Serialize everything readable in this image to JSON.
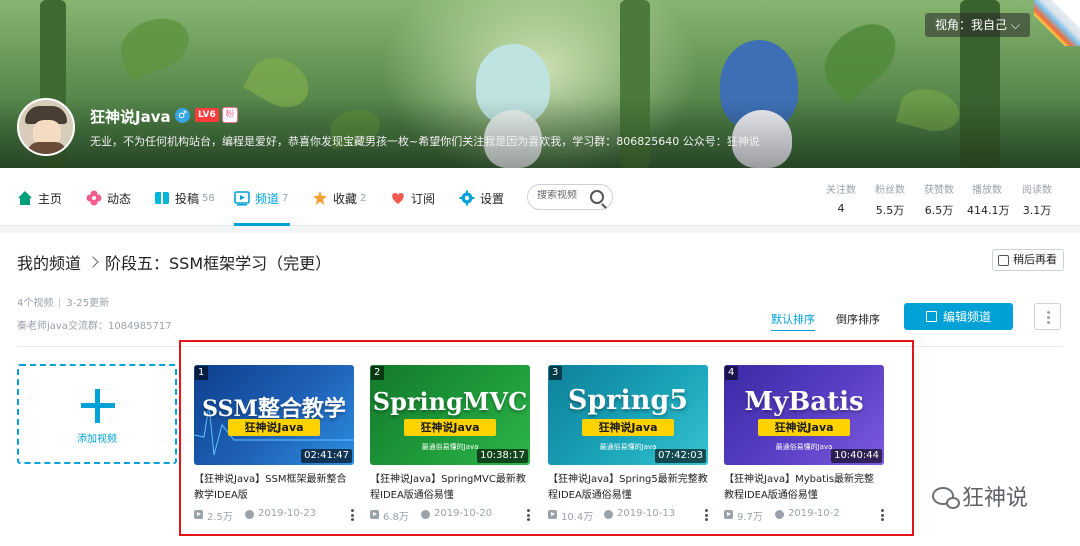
{
  "banner": {
    "view_as": "视角：我自己",
    "username": "狂神说Java",
    "level_badge": "LV6",
    "fan_badge": "粉",
    "sign": "无业，不为任何机构站台，编程是爱好，恭喜你发现宝藏男孩一枚~希望你们关注我是因为喜欢我，学习群：806825640 公众号：狂神说"
  },
  "nav": {
    "items": [
      {
        "label": "主页",
        "count": "",
        "icon": "home-icon",
        "color": "#00a07a"
      },
      {
        "label": "动态",
        "count": "",
        "icon": "flower-icon",
        "color": "#f25d8e"
      },
      {
        "label": "投稿",
        "count": "58",
        "icon": "upload-icon",
        "color": "#02b5da"
      },
      {
        "label": "频道",
        "count": "7",
        "icon": "channel-icon",
        "color": "#00a1d6"
      },
      {
        "label": "收藏",
        "count": "2",
        "icon": "star-icon",
        "color": "#f3a034"
      },
      {
        "label": "订阅",
        "count": "",
        "icon": "heart-icon",
        "color": "#f45a50"
      },
      {
        "label": "设置",
        "count": "",
        "icon": "gear-icon",
        "color": "#00a1d6"
      }
    ],
    "active": "频道",
    "search_placeholder": "搜索视频"
  },
  "stats": [
    {
      "label": "关注数",
      "value": "4"
    },
    {
      "label": "粉丝数",
      "value": "5.5万"
    },
    {
      "label": "获赞数",
      "value": "6.5万"
    },
    {
      "label": "播放数",
      "value": "414.1万"
    },
    {
      "label": "阅读数",
      "value": "3.1万"
    }
  ],
  "content": {
    "breadcrumb_root": "我的频道",
    "breadcrumb_current": "阶段五：SSM框架学习（完更）",
    "watch_later": "稍后再看",
    "video_count": "4个视频",
    "updated": "3-25更新",
    "description": "秦老师java交流群：1084985717",
    "sort_default": "默认排序",
    "sort_reverse": "倒序排序",
    "edit_button": "编辑频道",
    "add_video": "添加视频",
    "accent_color": "#00a1d6",
    "highlight_color": "#e3141a"
  },
  "videos": [
    {
      "index": "1",
      "thumb_text": "SSM整合教学",
      "tag": "狂神说Java",
      "slogan": "",
      "duration": "02:41:47",
      "title": "【狂神说Java】SSM框架最新整合教学IDEA版",
      "views": "2.5万",
      "date": "2019-10-23",
      "bg": "#1f62b8"
    },
    {
      "index": "2",
      "thumb_text": "SpringMVC",
      "tag": "狂神说Java",
      "slogan": "最通俗易懂的Java",
      "duration": "10:38:17",
      "title": "【狂神说Java】SpringMVC最新教程IDEA版通俗易懂",
      "views": "6.8万",
      "date": "2019-10-20",
      "bg": "#1e9b3a"
    },
    {
      "index": "3",
      "thumb_text": "Spring5",
      "tag": "狂神说Java",
      "slogan": "最通俗易懂的Java",
      "duration": "07:42:03",
      "title": "【狂神说Java】Spring5最新完整教程IDEA版通俗易懂",
      "views": "10.4万",
      "date": "2019-10-13",
      "bg": "#1aa4b8"
    },
    {
      "index": "4",
      "thumb_text": "MyBatis",
      "tag": "狂神说Java",
      "slogan": "最通俗易懂的Java",
      "duration": "10:40:44",
      "title": "【狂神说Java】Mybatis最新完整教程IDEA版通俗易懂",
      "views": "9.7万",
      "date": "2019-10-2",
      "bg": "#5a3fc4"
    }
  ],
  "watermark": "狂神说"
}
